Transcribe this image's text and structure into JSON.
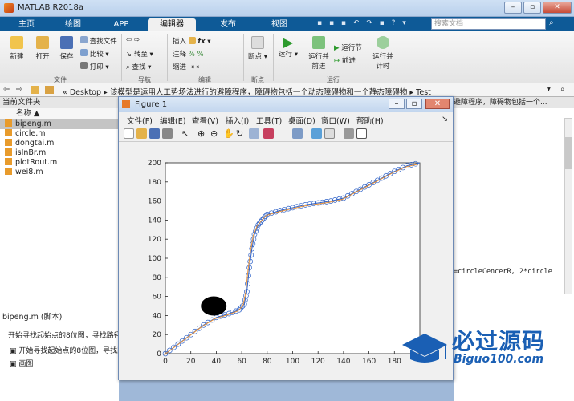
{
  "window": {
    "title": "MATLAB R2018a"
  },
  "tabs": [
    "主页",
    "绘图",
    "APP",
    "编辑器",
    "发布",
    "视图"
  ],
  "search": {
    "placeholder": "搜索文档"
  },
  "ribbon": {
    "file": {
      "new": "新建",
      "open": "打开",
      "save": "保存",
      "find_files": "查找文件",
      "compare": "比较",
      "print": "打印",
      "group": "文件"
    },
    "nav": {
      "goto": "转至",
      "find": "查找",
      "group": "导航"
    },
    "edit": {
      "insert": "插入",
      "comment": "注释",
      "indent": "缩进",
      "fx": "fx",
      "group": "编辑"
    },
    "breakpoints": {
      "label": "断点",
      "group": "断点"
    },
    "run": {
      "run": "运行",
      "run_advance": "运行并\n前进",
      "run_section": "运行节",
      "advance": "前进",
      "run_time": "运行并\n计时",
      "group": "运行"
    }
  },
  "address": {
    "path": [
      "Desktop",
      "该模型是运用人工势场法进行的避障程序，障碍物包括一个动态障碍物和一个静态障碍物",
      "Test"
    ]
  },
  "current_folder": {
    "title": "当前文件夹",
    "column": "名称 ▲",
    "files": [
      "bipeng.m",
      "circle.m",
      "dongtai.m",
      "isInBr.m",
      "plotRout.m",
      "wei8.m"
    ]
  },
  "details": {
    "file": "bipeng.m  (脚本)",
    "text": "开始寻找起始点的8位图，寻找路径",
    "outline": [
      "开始寻找起始点的8位图，寻找路",
      "画图"
    ]
  },
  "editor_snippet": {
    "tail": "避障程序，障碍物包括一个...",
    "code": "=circleCencerR, 2*circle("
  },
  "figure": {
    "title": "Figure 1",
    "menu": [
      "文件(F)",
      "编辑(E)",
      "查看(V)",
      "插入(I)",
      "工具(T)",
      "桌面(D)",
      "窗口(W)",
      "帮助(H)"
    ]
  },
  "watermark": {
    "text": "必过源码",
    "url": "Biguo100.com"
  },
  "chart_data": {
    "type": "line",
    "xlim": [
      0,
      200
    ],
    "ylim": [
      0,
      200
    ],
    "xticks": [
      0,
      20,
      40,
      60,
      80,
      100,
      120,
      140,
      160,
      180
    ],
    "yticks": [
      0,
      20,
      40,
      60,
      80,
      100,
      120,
      140,
      160,
      180,
      200
    ],
    "series": [
      {
        "color": "#2e62c8",
        "marker": "circle",
        "x": [
          0,
          10,
          20,
          30,
          40,
          50,
          58,
          62,
          64,
          66,
          68,
          70,
          73,
          76,
          80,
          90,
          100,
          110,
          120,
          130,
          140,
          150,
          160,
          170,
          180,
          190,
          200
        ],
        "y": [
          0,
          10,
          20,
          30,
          38,
          42,
          46,
          52,
          65,
          90,
          110,
          125,
          135,
          140,
          146,
          150,
          153,
          156,
          158,
          160,
          163,
          170,
          177,
          184,
          191,
          197,
          200
        ]
      },
      {
        "color": "#e8923a",
        "marker": "none",
        "x": [
          0,
          10,
          20,
          30,
          40,
          50,
          58,
          62,
          64,
          66,
          68,
          70,
          73,
          76,
          80,
          90,
          100,
          110,
          120,
          130,
          140,
          150,
          160,
          170,
          180,
          190,
          200
        ],
        "y": [
          0,
          10,
          20,
          30,
          38,
          42,
          46,
          52,
          65,
          90,
          110,
          125,
          135,
          140,
          146,
          150,
          153,
          156,
          158,
          160,
          163,
          170,
          177,
          184,
          191,
          197,
          200
        ]
      }
    ],
    "obstacle": {
      "x": 38,
      "y": 50,
      "color": "#000000"
    }
  }
}
